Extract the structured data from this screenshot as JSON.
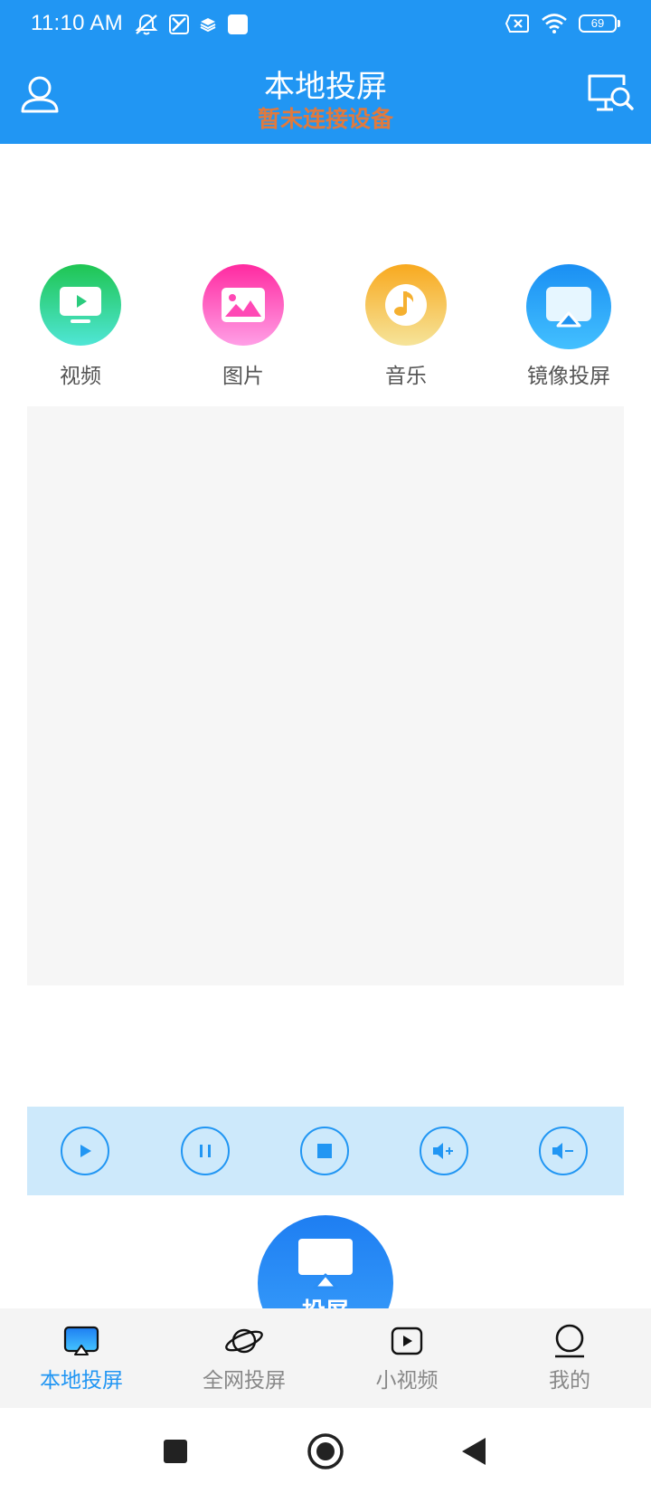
{
  "status_bar": {
    "time": "11:10 AM",
    "battery": "69"
  },
  "header": {
    "title": "本地投屏",
    "subtitle": "暂未连接设备",
    "bg_color": "#2196F3",
    "subtitle_color": "#E07A3E"
  },
  "categories": [
    {
      "label": "视频",
      "icon": "video-icon",
      "color": "#2ED573"
    },
    {
      "label": "图片",
      "icon": "image-icon",
      "color": "#FF4FB8"
    },
    {
      "label": "音乐",
      "icon": "music-icon",
      "color": "#F9C22E"
    },
    {
      "label": "镜像投屏",
      "icon": "mirror-cast-icon",
      "color": "#2196F3"
    }
  ],
  "controls": [
    {
      "icon": "play-icon"
    },
    {
      "icon": "pause-icon"
    },
    {
      "icon": "stop-icon"
    },
    {
      "icon": "volume-up-icon"
    },
    {
      "icon": "volume-down-icon"
    }
  ],
  "cast_button": {
    "label": "投屏"
  },
  "bottom_nav": [
    {
      "label": "本地投屏",
      "icon": "local-cast-icon",
      "active": true
    },
    {
      "label": "全网投屏",
      "icon": "planet-icon",
      "active": false
    },
    {
      "label": "小视频",
      "icon": "short-video-icon",
      "active": false
    },
    {
      "label": "我的",
      "icon": "profile-icon",
      "active": false
    }
  ],
  "colors": {
    "accent": "#2196F3",
    "controls_bg": "#CDE9FB",
    "panel_bg": "#F6F6F6"
  }
}
